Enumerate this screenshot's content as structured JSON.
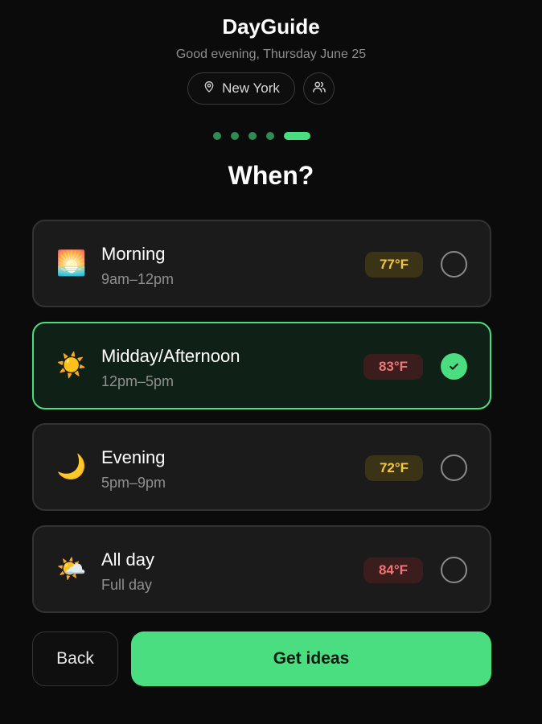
{
  "app": {
    "title": "DayGuide",
    "greeting": "Good evening, Thursday June 25"
  },
  "location": {
    "label": "New York",
    "icon": "map-pin-icon"
  },
  "people_icon": "users-icon",
  "progress": {
    "total_steps": 5,
    "current_step": 5
  },
  "question": "When?",
  "options": [
    {
      "label": "Morning",
      "time": "9am–12pm",
      "temp": "77°F",
      "temp_color": "#f5c542",
      "emoji": "🌅",
      "selected": false
    },
    {
      "label": "Midday/Afternoon",
      "time": "12pm–5pm",
      "temp": "83°F",
      "temp_color": "#f07575",
      "emoji": "☀️",
      "selected": true
    },
    {
      "label": "Evening",
      "time": "5pm–9pm",
      "temp": "72°F",
      "temp_color": "#f5c542",
      "emoji": "🌙",
      "selected": false
    },
    {
      "label": "All day",
      "time": "Full day",
      "temp": "84°F",
      "temp_color": "#f07575",
      "emoji": "🌤️",
      "selected": false
    }
  ],
  "actions": {
    "back_label": "Back",
    "submit_label": "Get ideas"
  },
  "colors": {
    "accent": "#4ade80",
    "background": "#0b0b0b",
    "card": "#1b1b1b"
  }
}
